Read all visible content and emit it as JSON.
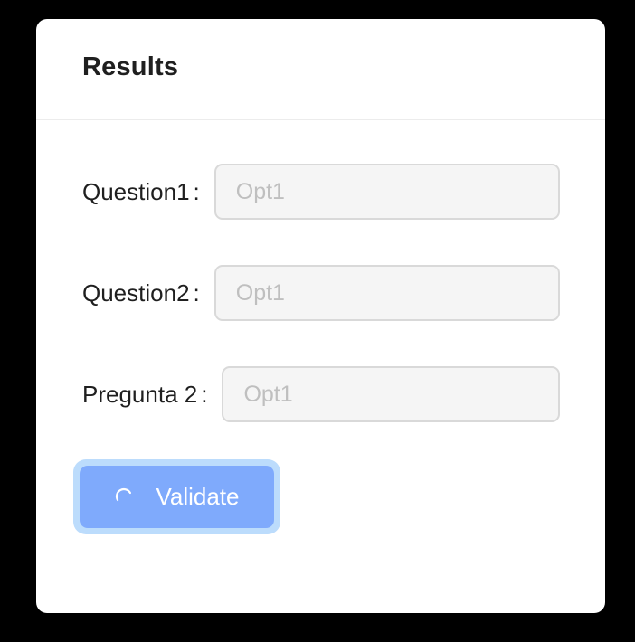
{
  "card": {
    "title": "Results"
  },
  "form": {
    "fields": [
      {
        "label": "Question1",
        "value": "",
        "placeholder": "Opt1"
      },
      {
        "label": "Question2",
        "value": "",
        "placeholder": "Opt1"
      },
      {
        "label": "Pregunta 2",
        "value": "",
        "placeholder": "Opt1"
      }
    ],
    "separator": ":"
  },
  "validate_button": {
    "label": "Validate",
    "icon": "loading-spinner-icon",
    "loading": true
  },
  "colors": {
    "background": "#000000",
    "card": "#ffffff",
    "button": "#7faafc",
    "button_focus_ring": "#bcdcfc",
    "input_bg": "#f5f5f5",
    "input_border": "#d9d9d9",
    "placeholder": "#bfbfbf",
    "text": "#1f1f1f"
  }
}
